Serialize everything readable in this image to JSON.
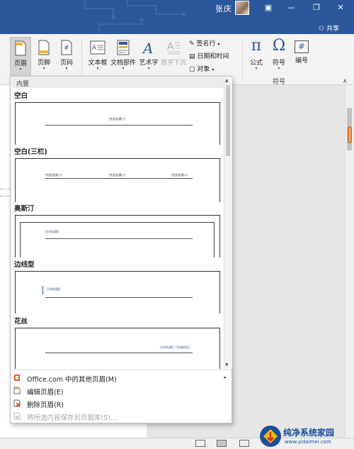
{
  "titlebar": {
    "user_name": "张庆",
    "share_label": "共享",
    "color": "#2b579a"
  },
  "ribbon": {
    "header_footer": [
      {
        "label": "页眉",
        "icon": "header-icon",
        "active": true
      },
      {
        "label": "页脚",
        "icon": "footer-icon"
      },
      {
        "label": "页码",
        "icon": "page-number-icon"
      }
    ],
    "text_group": [
      {
        "label": "文本框",
        "icon": "textbox-icon"
      },
      {
        "label": "文档部件",
        "icon": "quick-parts-icon"
      },
      {
        "label": "艺术字",
        "icon": "wordart-icon"
      },
      {
        "label": "首字下沉",
        "icon": "dropcap-icon",
        "disabled": true
      }
    ],
    "text_small": [
      {
        "label": "签名行",
        "icon": "signature-line-icon"
      },
      {
        "label": "日期和时间",
        "icon": "datetime-icon"
      },
      {
        "label": "对象",
        "icon": "object-icon"
      }
    ],
    "symbols_group": [
      {
        "label": "公式",
        "icon": "equation-icon",
        "glyph": "π"
      },
      {
        "label": "符号",
        "icon": "symbol-icon",
        "glyph": "Ω"
      },
      {
        "label": "编号",
        "icon": "number-icon",
        "glyph": "#"
      }
    ],
    "symbols_group_label": "符号"
  },
  "dropdown": {
    "section_label": "内置",
    "templates": [
      {
        "name": "空白",
        "placeholders": [
          "[在此处键入]"
        ]
      },
      {
        "name": "空白(三栏)",
        "placeholders": [
          "[在此处键入]",
          "[在此处键入]",
          "[在此处键入]"
        ]
      },
      {
        "name": "奥斯汀",
        "placeholders": [
          "[文档标题]"
        ]
      },
      {
        "name": "边线型",
        "placeholders": [
          "[文档标题]"
        ]
      },
      {
        "name": "花丝",
        "placeholders": [
          "[文档标题] | [作者姓名]"
        ]
      }
    ],
    "menu": [
      {
        "label": "Office.com 中的其他页眉(M)",
        "icon": "office-icon",
        "has_submenu": true
      },
      {
        "label": "编辑页眉(E)",
        "icon": "edit-header-icon"
      },
      {
        "label": "删除页眉(R)",
        "icon": "remove-header-icon"
      },
      {
        "label": "将所选内容保存到页眉库(S)...",
        "icon": "save-selection-icon",
        "disabled": true
      }
    ]
  },
  "watermark": {
    "text": "纯净系统家园",
    "url": "www.yidaimei.com"
  }
}
